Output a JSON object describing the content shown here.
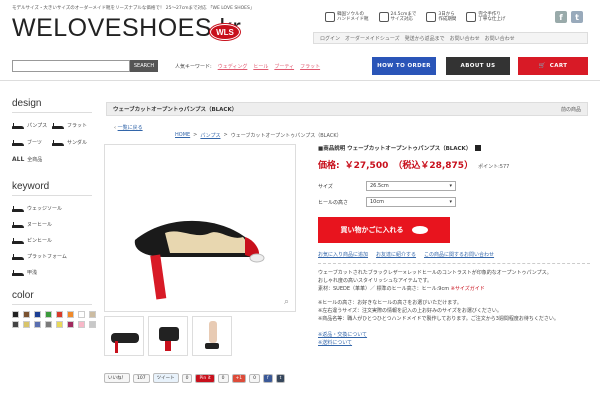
{
  "header": {
    "tagline": "モデルサイズ・大きいサイズのオーダーメイド靴をリーズナブルな価格で！ 25〜27cmまで対応 「WE LOVE SHOES」",
    "logo_text": "WELOVESHOES.kr",
    "logo_badge": "WLS",
    "features": [
      "韓国ソウルの\nハンドメイド靴",
      "24.5cmまで\nサイズ対応",
      "3日から\n作成期間",
      "完全手作り\n丁寧な仕上げ"
    ],
    "social": [
      "f",
      "t"
    ],
    "nav": [
      "ログイン",
      "オーダーメイドシューズ",
      "発送から返品まで",
      "お問い合わせ",
      "お問い合わせ"
    ],
    "search_placeholder": "",
    "search_button": "SEARCH",
    "keyword_label": "人気キーワード:",
    "keywords": [
      "ウェディング",
      "ヒール",
      "ブーティ",
      "フラット"
    ],
    "how_to_order": "HOW TO ORDER",
    "about_us": "ABOUT US",
    "cart": "CART"
  },
  "sidebar": {
    "design_title": "design",
    "design_items": [
      "パンプス",
      "フラット",
      "ブーツ",
      "サンダル"
    ],
    "all_label": "ALL",
    "all_text": "全商品",
    "keyword_title": "keyword",
    "keyword_items": [
      "ウェッジソール",
      "ヌーヒール",
      "ピンヒール",
      "プラットフォーム",
      "甲浅"
    ],
    "color_title": "color",
    "colors": [
      "#222222",
      "#7a5230",
      "#1c3f94",
      "#3a9a3a",
      "#d83a2a",
      "#f08a2a",
      "#ffffff",
      "#ccbca2",
      "#444444",
      "#d8c46a",
      "#5a6fb0",
      "#7a7a7a",
      "#e8d95a",
      "#a12a5e",
      "#f8b8c8",
      "#c8c8c8"
    ]
  },
  "breadcrumb": {
    "title": "ウェーブカットオープントゥパンプス（BLACK）",
    "back": "前の商品",
    "list_link": "一覧に戻る",
    "home": "HOME",
    "category": "パンプス",
    "current": "ウェーブカットオープントゥパンプス（BLACK）"
  },
  "product": {
    "heading": "■商品説明 ウェーブカットオープントゥパンプス（BLACK）",
    "price_label": "価格:",
    "price": "￥27,500",
    "tax_price": "（税込￥28,875）",
    "points": "ポイント:577",
    "size_label": "サイズ",
    "size_value": "26.5cm",
    "heel_label": "ヒールの高さ",
    "heel_value": "10cm",
    "cart_button": "買い物かごに入れる",
    "links": [
      "お気に入り商品に追加",
      "お友達に紹介する",
      "この商品に関するお問い合わせ"
    ],
    "desc1": "ウェーブカットされたブラックレザー×レッドヒールのコントラストが印象的なオープントゥパンプス。",
    "desc2": "おしゃれ度の高いスタイリッシュなアイテムです。",
    "material": "素材：SUEDE（革革）／ 標準のヒール高さ：ヒール:9cm",
    "size_guide": "※サイズガイド",
    "note1": "※ヒールの高さ：お好きなヒールの高さをお選びいただけます。",
    "note2": "※左右違うサイズ：注文実際の情報を記入の上お好みのサイズをお選びください。",
    "note3": "※商品名等：職人がひとつひとつハンドメイドで製作しております。ご注文から3週間程度お待ちください。",
    "shipping": "※返品・交換について",
    "delivery": "※送料について"
  },
  "share": {
    "like": "いいね！",
    "like_count": "107",
    "tweet": "ツイート",
    "tweet_count": "0",
    "pin": "Pin it",
    "pin_count": "0",
    "plusone": "+1",
    "plus_count": "0"
  }
}
